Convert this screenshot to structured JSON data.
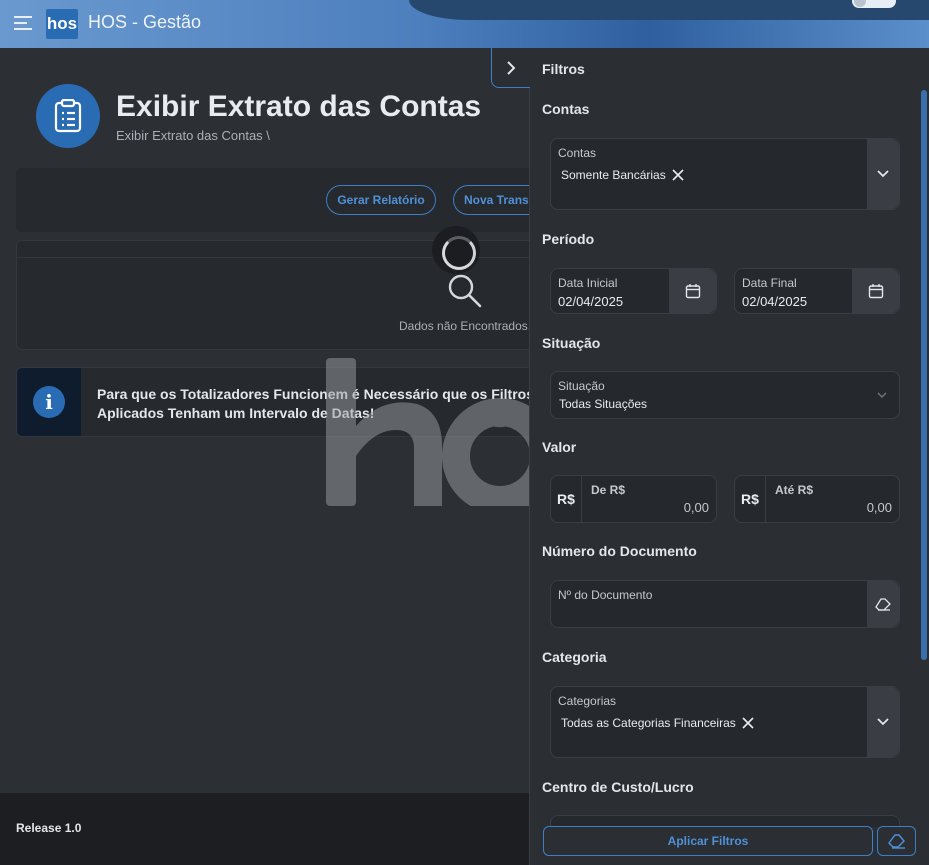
{
  "header": {
    "logo_text": "hos",
    "app_title": "HOS - Gestão"
  },
  "page": {
    "title": "Exibir Extrato das Contas",
    "breadcrumb": "Exibir Extrato das Contas  \\"
  },
  "toolbar": {
    "report_label": "Gerar Relatório",
    "new_transfer_label": "Nova Transferência"
  },
  "results": {
    "empty_text": "Dados não Encontrados."
  },
  "info": {
    "message": "Para que os Totalizadores Funcionem é Necessário que os Filtros Aplicados Tenham um Intervalo de Datas!"
  },
  "footer": {
    "release": "Release 1.0"
  },
  "filters": {
    "title": "Filtros",
    "contas": {
      "section": "Contas",
      "label": "Contas",
      "chip": "Somente Bancárias"
    },
    "periodo": {
      "section": "Período",
      "start_label": "Data Inicial",
      "start_value": "02/04/2025",
      "end_label": "Data Final",
      "end_value": "02/04/2025"
    },
    "situacao": {
      "section": "Situação",
      "label": "Situação",
      "value": "Todas Situações"
    },
    "valor": {
      "section": "Valor",
      "currency": "R$",
      "from_label": "De R$",
      "from_value": "0,00",
      "to_label": "Até R$",
      "to_value": "0,00"
    },
    "documento": {
      "section": "Número do Documento",
      "label": "Nº do Documento"
    },
    "categoria": {
      "section": "Categoria",
      "label": "Categorias",
      "chip": "Todas as Categorias Financeiras"
    },
    "centro_custo": {
      "section": "Centro de Custo/Lucro"
    },
    "apply_label": "Aplicar Filtros"
  },
  "colors": {
    "accent": "#2a6cb3",
    "outline": "#3d7fc7",
    "background": "#2c2f34",
    "panel": "#2b2e33"
  }
}
